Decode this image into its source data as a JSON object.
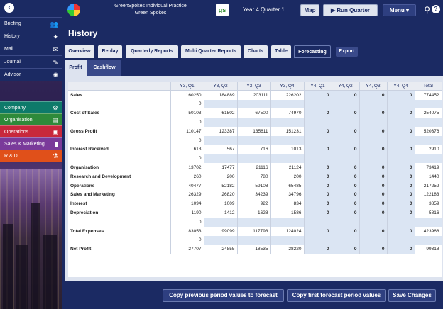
{
  "header": {
    "company_line1": "GreenSpokes Individual Practice",
    "company_line2": "Green Spokes",
    "logo_text": "gs",
    "period": "Year 4 Quarter 1",
    "map_label": "Map",
    "run_quarter_label": "Run Quarter",
    "menu_label": "Menu",
    "help_label": "?"
  },
  "sidebar": {
    "nav": [
      {
        "label": "Briefing",
        "icon": "people-icon"
      },
      {
        "label": "History",
        "icon": "network-icon"
      },
      {
        "label": "Mail",
        "icon": "envelope-icon"
      },
      {
        "label": "Journal",
        "icon": "pencil-icon"
      },
      {
        "label": "Advisor",
        "icon": "lightbulb-icon"
      }
    ],
    "modules": [
      {
        "label": "Company",
        "icon": "gears-icon",
        "color": "#0e7a6a"
      },
      {
        "label": "Organisation",
        "icon": "clipboard-icon",
        "color": "#2e8a3a"
      },
      {
        "label": "Operations",
        "icon": "boxes-icon",
        "color": "#c8283c"
      },
      {
        "label": "Sales & Marketing",
        "icon": "bar-chart-icon",
        "color": "#7a3a9a"
      },
      {
        "label": "R & D",
        "icon": "flask-icon",
        "color": "#e0501a"
      }
    ]
  },
  "page_title": "History",
  "tabs": [
    {
      "label": "Overview"
    },
    {
      "label": "Replay"
    },
    {
      "label": "Quarterly Reports"
    },
    {
      "label": "Multi Quarter Reports"
    },
    {
      "label": "Charts"
    },
    {
      "label": "Table"
    },
    {
      "label": "Forecasting"
    }
  ],
  "export_label": "Export",
  "subtabs": [
    {
      "label": "Profit"
    },
    {
      "label": "Cashflow"
    }
  ],
  "table": {
    "columns": [
      "",
      "Y3, Q1",
      "Y3, Q2",
      "Y3, Q3",
      "Y3, Q4",
      "Y4, Q1",
      "Y4, Q2",
      "Y4, Q3",
      "Y4, Q4",
      "Total"
    ],
    "rows": [
      {
        "label": "Sales",
        "values": [
          "160250",
          "184889",
          "203111",
          "226202",
          "0",
          "0",
          "0",
          "0",
          "774452"
        ],
        "kind": "main"
      },
      {
        "label": "",
        "values": [
          "0",
          "",
          "",
          "",
          "",
          "",
          "",
          "",
          ""
        ],
        "kind": "sub"
      },
      {
        "label": "Cost of Sales",
        "values": [
          "50103",
          "61502",
          "67500",
          "74970",
          "0",
          "0",
          "0",
          "0",
          "254075"
        ],
        "kind": "main"
      },
      {
        "label": "",
        "values": [
          "0",
          "",
          "",
          "",
          "",
          "",
          "",
          "",
          ""
        ],
        "kind": "sub"
      },
      {
        "label": "Gross Profit",
        "values": [
          "110147",
          "123387",
          "135611",
          "151231",
          "0",
          "0",
          "0",
          "0",
          "520376"
        ],
        "kind": "main"
      },
      {
        "label": "",
        "values": [
          "0",
          "",
          "",
          "",
          "",
          "",
          "",
          "",
          ""
        ],
        "kind": "sub"
      },
      {
        "label": "Interest Received",
        "values": [
          "613",
          "567",
          "716",
          "1013",
          "0",
          "0",
          "0",
          "0",
          "2910"
        ],
        "kind": "main"
      },
      {
        "label": "",
        "values": [
          "0",
          "",
          "",
          "",
          "",
          "",
          "",
          "",
          ""
        ],
        "kind": "sub"
      },
      {
        "label": "Organisation",
        "values": [
          "13702",
          "17477",
          "21116",
          "21124",
          "0",
          "0",
          "0",
          "0",
          "73419"
        ],
        "kind": "main"
      },
      {
        "label": "Research and Development",
        "values": [
          "260",
          "200",
          "780",
          "200",
          "0",
          "0",
          "0",
          "0",
          "1440"
        ],
        "kind": "main"
      },
      {
        "label": "Operations",
        "values": [
          "40477",
          "52182",
          "59108",
          "65485",
          "0",
          "0",
          "0",
          "0",
          "217252"
        ],
        "kind": "main"
      },
      {
        "label": "Sales and Marketing",
        "values": [
          "26329",
          "26820",
          "34239",
          "34796",
          "0",
          "0",
          "0",
          "0",
          "122183"
        ],
        "kind": "main"
      },
      {
        "label": "Interest",
        "values": [
          "1094",
          "1009",
          "922",
          "834",
          "0",
          "0",
          "0",
          "0",
          "3859"
        ],
        "kind": "main"
      },
      {
        "label": "Depreciation",
        "values": [
          "1190",
          "1412",
          "1628",
          "1586",
          "0",
          "0",
          "0",
          "0",
          "5816"
        ],
        "kind": "main"
      },
      {
        "label": "",
        "values": [
          "0",
          "",
          "",
          "",
          "",
          "",
          "",
          "",
          ""
        ],
        "kind": "sub"
      },
      {
        "label": "Total Expenses",
        "values": [
          "83053",
          "99099",
          "117793",
          "124024",
          "0",
          "0",
          "0",
          "0",
          "423968"
        ],
        "kind": "main"
      },
      {
        "label": "",
        "values": [
          "0",
          "",
          "",
          "",
          "",
          "",
          "",
          "",
          ""
        ],
        "kind": "sub"
      },
      {
        "label": "Net Profit",
        "values": [
          "27707",
          "24855",
          "18535",
          "28220",
          "0",
          "0",
          "0",
          "0",
          "99318"
        ],
        "kind": "main"
      }
    ]
  },
  "buttons": {
    "copy_previous": "Copy previous period values to forecast",
    "copy_first": "Copy first forecast period values",
    "save": "Save Changes"
  }
}
